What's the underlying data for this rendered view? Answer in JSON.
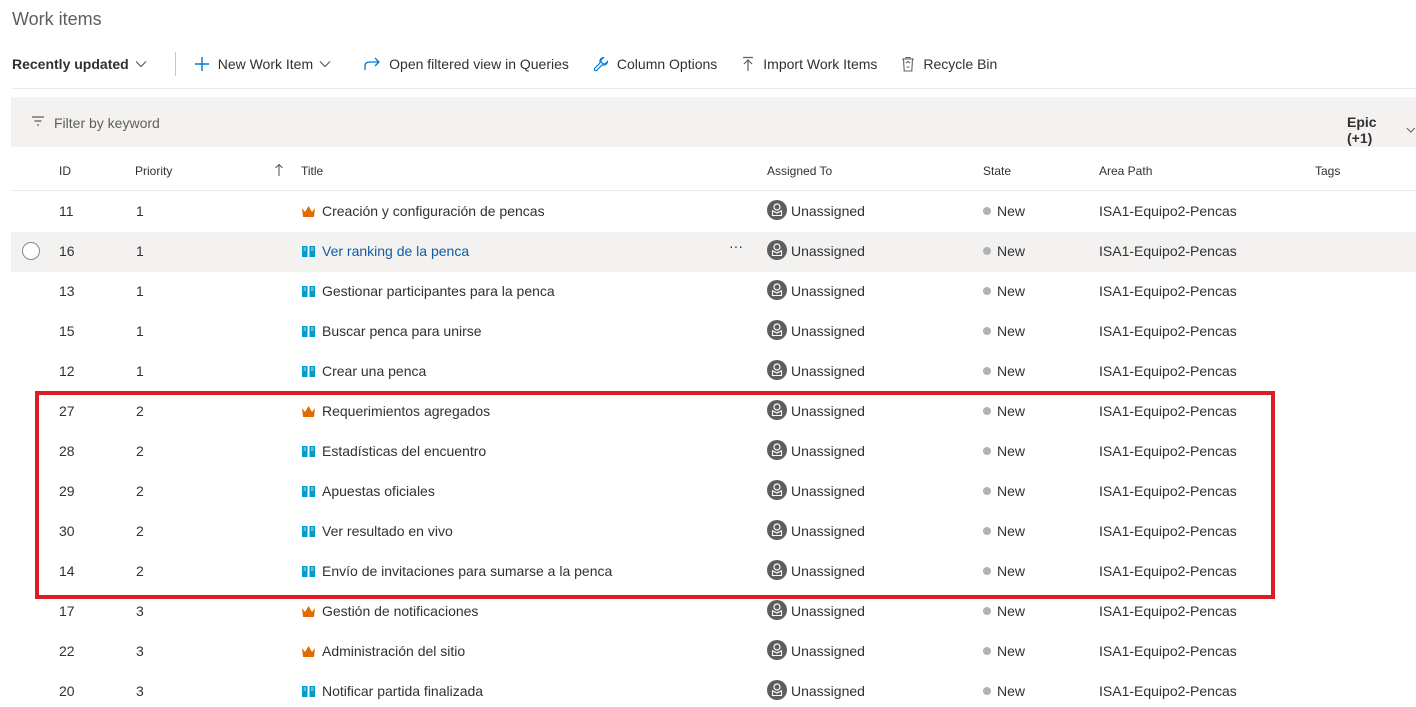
{
  "page": {
    "title": "Work items"
  },
  "toolbar": {
    "view_label": "Recently updated",
    "new_item_label": "New Work Item",
    "open_queries_label": "Open filtered view in Queries",
    "column_options_label": "Column Options",
    "import_label": "Import Work Items",
    "recycle_label": "Recycle Bin"
  },
  "filter": {
    "placeholder": "Filter by keyword",
    "type_pill": "Epic (+1)"
  },
  "columns": {
    "id": "ID",
    "priority": "Priority",
    "title": "Title",
    "assigned": "Assigned To",
    "state": "State",
    "area": "Area Path",
    "tags": "Tags"
  },
  "colors": {
    "epic_icon": "#e06c00",
    "story_icon": "#009ccc",
    "highlight": "#e01b24",
    "link": "#0f5ca6"
  },
  "rows": [
    {
      "id": "11",
      "priority": "1",
      "type_icon": "crown-icon",
      "title": "Creación y configuración de pencas",
      "assigned": "Unassigned",
      "state": "New",
      "area": "ISA1-Equipo2-Pencas"
    },
    {
      "id": "16",
      "priority": "1",
      "type_icon": "book-icon",
      "title": "Ver ranking de la penca",
      "assigned": "Unassigned",
      "state": "New",
      "area": "ISA1-Equipo2-Pencas",
      "hover": true,
      "more": "···"
    },
    {
      "id": "13",
      "priority": "1",
      "type_icon": "book-icon",
      "title": "Gestionar participantes para la penca",
      "assigned": "Unassigned",
      "state": "New",
      "area": "ISA1-Equipo2-Pencas"
    },
    {
      "id": "15",
      "priority": "1",
      "type_icon": "book-icon",
      "title": "Buscar penca para unirse",
      "assigned": "Unassigned",
      "state": "New",
      "area": "ISA1-Equipo2-Pencas"
    },
    {
      "id": "12",
      "priority": "1",
      "type_icon": "book-icon",
      "title": "Crear una penca",
      "assigned": "Unassigned",
      "state": "New",
      "area": "ISA1-Equipo2-Pencas"
    },
    {
      "id": "27",
      "priority": "2",
      "type_icon": "crown-icon",
      "title": "Requerimientos agregados",
      "assigned": "Unassigned",
      "state": "New",
      "area": "ISA1-Equipo2-Pencas"
    },
    {
      "id": "28",
      "priority": "2",
      "type_icon": "book-icon",
      "title": "Estadísticas del encuentro",
      "assigned": "Unassigned",
      "state": "New",
      "area": "ISA1-Equipo2-Pencas"
    },
    {
      "id": "29",
      "priority": "2",
      "type_icon": "book-icon",
      "title": "Apuestas oficiales",
      "assigned": "Unassigned",
      "state": "New",
      "area": "ISA1-Equipo2-Pencas"
    },
    {
      "id": "30",
      "priority": "2",
      "type_icon": "book-icon",
      "title": "Ver resultado en vivo",
      "assigned": "Unassigned",
      "state": "New",
      "area": "ISA1-Equipo2-Pencas"
    },
    {
      "id": "14",
      "priority": "2",
      "type_icon": "book-icon",
      "title": "Envío de invitaciones para sumarse a la penca",
      "assigned": "Unassigned",
      "state": "New",
      "area": "ISA1-Equipo2-Pencas"
    },
    {
      "id": "17",
      "priority": "3",
      "type_icon": "crown-icon",
      "title": "Gestión de notificaciones",
      "assigned": "Unassigned",
      "state": "New",
      "area": "ISA1-Equipo2-Pencas"
    },
    {
      "id": "22",
      "priority": "3",
      "type_icon": "crown-icon",
      "title": "Administración del sitio",
      "assigned": "Unassigned",
      "state": "New",
      "area": "ISA1-Equipo2-Pencas"
    },
    {
      "id": "20",
      "priority": "3",
      "type_icon": "book-icon",
      "title": "Notificar partida finalizada",
      "assigned": "Unassigned",
      "state": "New",
      "area": "ISA1-Equipo2-Pencas"
    }
  ]
}
